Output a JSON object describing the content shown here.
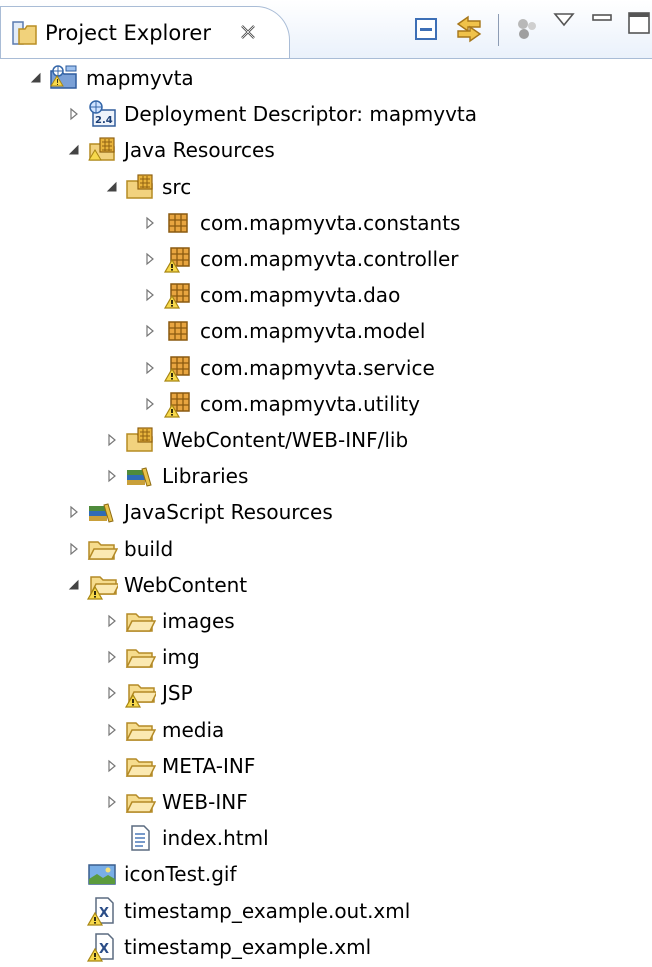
{
  "view": {
    "title": "Project Explorer",
    "close_icon": "close-x-icon",
    "toolbar": [
      "collapse-all-icon",
      "link-with-editor-icon",
      "dot-icons",
      "view-menu-icon",
      "minimize-icon",
      "maximize-icon"
    ]
  },
  "tree": {
    "items": [
      {
        "label": "mapmyvta",
        "level": 0,
        "expanded": true,
        "icon": "web-project-icon"
      },
      {
        "label": "Deployment Descriptor: mapmyvta",
        "level": 1,
        "expanded": false,
        "icon": "deployment-descriptor-icon"
      },
      {
        "label": "Java Resources",
        "level": 1,
        "expanded": true,
        "icon": "java-resources-icon"
      },
      {
        "label": "src",
        "level": 2,
        "expanded": true,
        "icon": "source-folder-icon"
      },
      {
        "label": "com.mapmyvta.constants",
        "level": 3,
        "expanded": false,
        "icon": "package-icon"
      },
      {
        "label": "com.mapmyvta.controller",
        "level": 3,
        "expanded": false,
        "icon": "package-warning-icon"
      },
      {
        "label": "com.mapmyvta.dao",
        "level": 3,
        "expanded": false,
        "icon": "package-warning-icon"
      },
      {
        "label": "com.mapmyvta.model",
        "level": 3,
        "expanded": false,
        "icon": "package-icon"
      },
      {
        "label": "com.mapmyvta.service",
        "level": 3,
        "expanded": false,
        "icon": "package-warning-icon"
      },
      {
        "label": "com.mapmyvta.utility",
        "level": 3,
        "expanded": false,
        "icon": "package-warning-icon"
      },
      {
        "label": "WebContent/WEB-INF/lib",
        "level": 2,
        "expanded": false,
        "icon": "source-folder-icon"
      },
      {
        "label": "Libraries",
        "level": 2,
        "expanded": false,
        "icon": "libraries-icon"
      },
      {
        "label": "JavaScript Resources",
        "level": 1,
        "expanded": false,
        "icon": "libraries-icon"
      },
      {
        "label": "build",
        "level": 1,
        "expanded": false,
        "icon": "folder-icon"
      },
      {
        "label": "WebContent",
        "level": 1,
        "expanded": true,
        "icon": "folder-warning-icon"
      },
      {
        "label": "images",
        "level": 2,
        "expanded": false,
        "icon": "folder-icon"
      },
      {
        "label": "img",
        "level": 2,
        "expanded": false,
        "icon": "folder-icon"
      },
      {
        "label": "JSP",
        "level": 2,
        "expanded": false,
        "icon": "folder-warning-icon"
      },
      {
        "label": "media",
        "level": 2,
        "expanded": false,
        "icon": "folder-icon"
      },
      {
        "label": "META-INF",
        "level": 2,
        "expanded": false,
        "icon": "folder-icon"
      },
      {
        "label": "WEB-INF",
        "level": 2,
        "expanded": false,
        "icon": "folder-icon"
      },
      {
        "label": "index.html",
        "level": 2,
        "expanded": null,
        "icon": "html-file-icon"
      },
      {
        "label": "iconTest.gif",
        "level": 1,
        "expanded": null,
        "icon": "image-file-icon"
      },
      {
        "label": "timestamp_example.out.xml",
        "level": 1,
        "expanded": null,
        "icon": "xml-warning-icon"
      },
      {
        "label": "timestamp_example.xml",
        "level": 1,
        "expanded": null,
        "icon": "xml-warning-icon"
      }
    ]
  }
}
